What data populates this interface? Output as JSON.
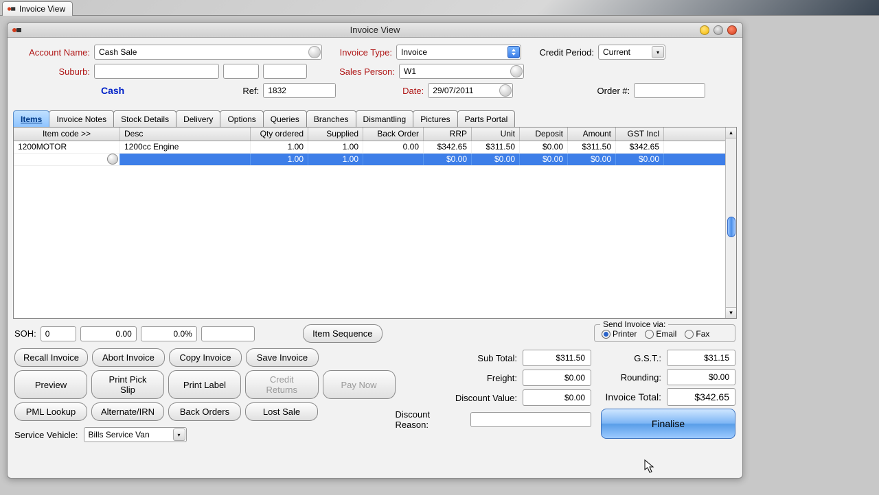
{
  "file_tab": {
    "title": "Invoice View"
  },
  "window": {
    "title": "Invoice View"
  },
  "form": {
    "account_name_label": "Account Name:",
    "account_name_value": "Cash Sale",
    "suburb_label": "Suburb:",
    "cash_label": "Cash",
    "ref_label": "Ref:",
    "ref_value": "1832",
    "invoice_type_label": "Invoice Type:",
    "invoice_type_value": "Invoice",
    "sales_person_label": "Sales Person:",
    "sales_person_value": "W1",
    "date_label": "Date:",
    "date_value": "29/07/2011",
    "credit_period_label": "Credit Period:",
    "credit_period_value": "Current",
    "order_label": "Order #:"
  },
  "tabs": {
    "items": "Items",
    "notes": "Invoice Notes",
    "stock": "Stock Details",
    "delivery": "Delivery",
    "options": "Options",
    "queries": "Queries",
    "branches": "Branches",
    "dismantling": "Dismantling",
    "pictures": "Pictures",
    "portal": "Parts Portal"
  },
  "grid": {
    "headers": {
      "item": "Item code >>",
      "desc": "Desc",
      "qty": "Qty ordered",
      "supplied": "Supplied",
      "back": "Back Order",
      "rrp": "RRP",
      "unit": "Unit",
      "deposit": "Deposit",
      "amount": "Amount",
      "gst": "GST Incl"
    },
    "row1": {
      "item": "1200MOTOR",
      "desc": "1200cc Engine",
      "qty": "1.00",
      "supplied": "1.00",
      "back": "0.00",
      "rrp": "$342.65",
      "unit": "$311.50",
      "deposit": "$0.00",
      "amount": "$311.50",
      "gst": "$342.65"
    },
    "row2": {
      "item": "",
      "desc": "",
      "qty": "1.00",
      "supplied": "1.00",
      "back": "",
      "rrp": "$0.00",
      "unit": "$0.00",
      "deposit": "$0.00",
      "amount": "$0.00",
      "gst": "$0.00"
    }
  },
  "soh": {
    "label": "SOH:",
    "v1": "0",
    "v2": "0.00",
    "v3": "0.0%",
    "item_seq": "Item Sequence"
  },
  "buttons": {
    "recall": "Recall Invoice",
    "abort": "Abort Invoice",
    "copy": "Copy Invoice",
    "save": "Save Invoice",
    "preview": "Preview",
    "pick": "Print Pick Slip",
    "label": "Print Label",
    "credit": "Credit Returns",
    "paynow": "Pay Now",
    "pml": "PML Lookup",
    "alt": "Alternate/IRN",
    "backorders": "Back Orders",
    "lost": "Lost Sale",
    "finalise": "Finalise"
  },
  "service_vehicle": {
    "label": "Service Vehicle:",
    "value": "Bills Service Van"
  },
  "send": {
    "legend": "Send Invoice via:",
    "printer": "Printer",
    "email": "Email",
    "fax": "Fax"
  },
  "totals": {
    "subtotal_label": "Sub Total:",
    "subtotal": "$311.50",
    "freight_label": "Freight:",
    "freight": "$0.00",
    "discount_label": "Discount Value:",
    "discount": "$0.00",
    "reason_label": "Discount Reason:",
    "gst_label": "G.S.T.:",
    "gst": "$31.15",
    "rounding_label": "Rounding:",
    "rounding": "$0.00",
    "invoice_total_label": "Invoice Total:",
    "invoice_total": "$342.65"
  }
}
